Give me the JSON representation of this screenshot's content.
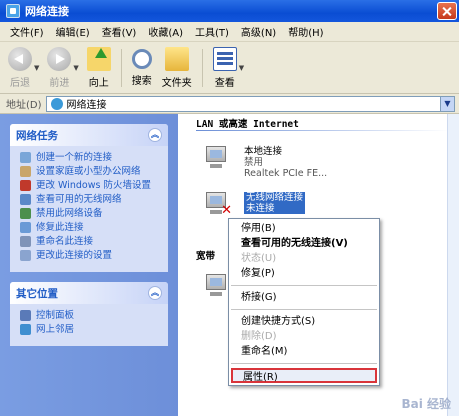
{
  "window": {
    "title": "网络连接"
  },
  "menubar": {
    "items": [
      "文件(F)",
      "编辑(E)",
      "查看(V)",
      "收藏(A)",
      "工具(T)",
      "高级(N)",
      "帮助(H)"
    ]
  },
  "toolbar": {
    "back": "后退",
    "forward": "前进",
    "up": "向上",
    "search": "搜索",
    "folders": "文件夹",
    "views": "查看"
  },
  "address": {
    "label": "地址(D)",
    "value": "网络连接"
  },
  "left": {
    "network_tasks": {
      "title": "网络任务",
      "items": [
        "创建一个新的连接",
        "设置家庭或小型办公网络",
        "更改 Windows 防火墙设置",
        "查看可用的无线网络",
        "禁用此网络设备",
        "修复此连接",
        "重命名此连接",
        "更改此连接的设置"
      ]
    },
    "other_places": {
      "title": "其它位置",
      "items": [
        "控制面板",
        "网上邻居"
      ]
    }
  },
  "content": {
    "group_lan": "LAN 或高速 Internet",
    "group_broadband": "宽带",
    "connections": [
      {
        "name": "本地连接",
        "status": "禁用",
        "device": "Realtek PCIe FE..."
      },
      {
        "name": "无线网络连接",
        "status": "未连接"
      }
    ]
  },
  "context_menu": {
    "items": [
      {
        "label": "停用(B)",
        "style": "normal"
      },
      {
        "label": "查看可用的无线连接(V)",
        "style": "bold"
      },
      {
        "label": "状态(U)",
        "style": "disabled"
      },
      {
        "label": "修复(P)",
        "style": "normal"
      },
      {
        "label": "桥接(G)",
        "style": "normal"
      },
      {
        "label": "创建快捷方式(S)",
        "style": "normal"
      },
      {
        "label": "删除(D)",
        "style": "disabled"
      },
      {
        "label": "重命名(M)",
        "style": "normal"
      },
      {
        "label": "属性(R)",
        "style": "highlighted"
      }
    ]
  },
  "watermark": "Bai 经验",
  "colors": {
    "titlebar": "#0a4dd3",
    "leftpane": "#7a9de2",
    "link": "#215dc6",
    "highlight_border": "#d9343a"
  }
}
